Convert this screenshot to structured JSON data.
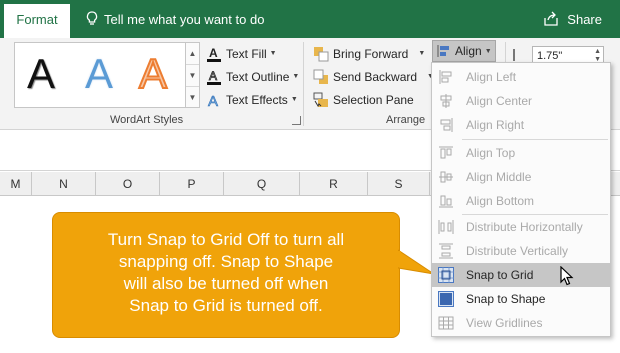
{
  "topbar": {
    "tab": "Format",
    "tell_me": "Tell me what you want to do",
    "share": "Share",
    "bar_color": "#217346"
  },
  "wordart": {
    "gallery_letter": "A",
    "text_fill": "Text Fill",
    "text_outline": "Text Outline",
    "text_effects": "Text Effects",
    "group_label": "WordArt Styles"
  },
  "arrange": {
    "bring_forward": "Bring Forward",
    "send_backward": "Send Backward",
    "selection_pane": "Selection Pane",
    "group_label": "Arrange",
    "align": "Align"
  },
  "size": {
    "height_value": "1.75\""
  },
  "columns": [
    "M",
    "N",
    "O",
    "P",
    "Q",
    "R",
    "S"
  ],
  "align_menu": {
    "items": [
      {
        "label": "Align Left",
        "icon": "align-left-icon",
        "enabled": false
      },
      {
        "label": "Align Center",
        "icon": "align-center-icon",
        "enabled": false
      },
      {
        "label": "Align Right",
        "icon": "align-right-icon",
        "enabled": false
      },
      {
        "label": "Align Top",
        "icon": "align-top-icon",
        "enabled": false
      },
      {
        "label": "Align Middle",
        "icon": "align-middle-icon",
        "enabled": false
      },
      {
        "label": "Align Bottom",
        "icon": "align-bottom-icon",
        "enabled": false
      },
      {
        "label": "Distribute Horizontally",
        "icon": "distribute-horizontally-icon",
        "enabled": false
      },
      {
        "label": "Distribute Vertically",
        "icon": "distribute-vertically-icon",
        "enabled": false
      },
      {
        "label": "Snap to Grid",
        "icon": "snap-to-grid-icon",
        "enabled": true,
        "highlighted": true
      },
      {
        "label": "Snap to Shape",
        "icon": "snap-to-shape-icon",
        "enabled": true
      },
      {
        "label": "View Gridlines",
        "icon": "view-gridlines-icon",
        "enabled": false
      }
    ]
  },
  "callout": {
    "lines": [
      "Turn Snap to Grid Off to turn all",
      "snapping off.  Snap to Shape",
      "will also be turned off when",
      "Snap to Grid is turned off."
    ],
    "color": "#f0a30a"
  }
}
